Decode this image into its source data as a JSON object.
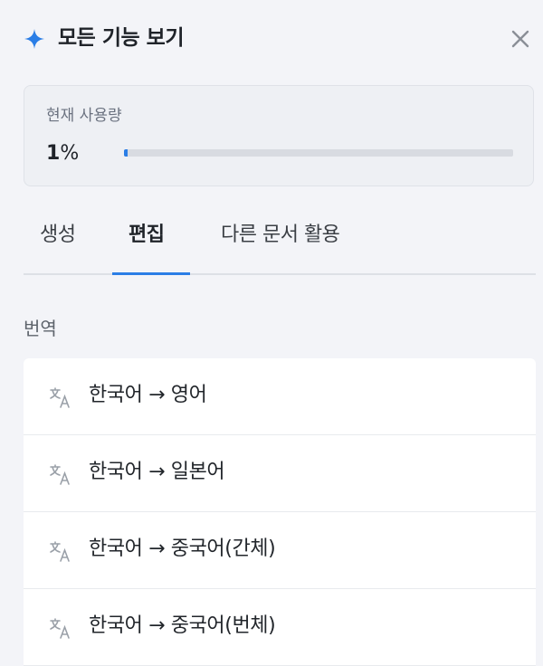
{
  "header": {
    "title": "모든 기능 보기",
    "sparkle_icon": "sparkle-icon",
    "close_icon": "close-icon"
  },
  "usage": {
    "label": "현재 사용량",
    "value_number": "1",
    "value_unit": "%",
    "percent": 1
  },
  "tabs": [
    {
      "label": "생성",
      "active": false
    },
    {
      "label": "편집",
      "active": true
    },
    {
      "label": "다른 문서 활용",
      "active": false
    }
  ],
  "section": {
    "label": "번역"
  },
  "items": [
    {
      "label": "한국어 → 영어",
      "icon": "translate-icon"
    },
    {
      "label": "한국어 → 일본어",
      "icon": "translate-icon"
    },
    {
      "label": "한국어 → 중국어(간체)",
      "icon": "translate-icon"
    },
    {
      "label": "한국어 → 중국어(번체)",
      "icon": "translate-icon"
    }
  ],
  "colors": {
    "accent": "#2b7ee6",
    "background": "#f3f4f8"
  }
}
